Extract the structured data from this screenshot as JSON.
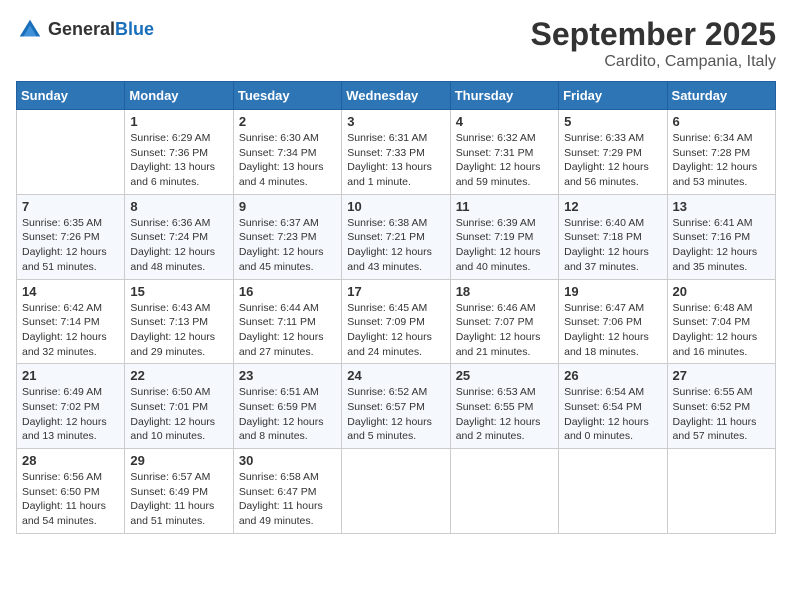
{
  "header": {
    "logo_general": "General",
    "logo_blue": "Blue",
    "month": "September 2025",
    "location": "Cardito, Campania, Italy"
  },
  "days_of_week": [
    "Sunday",
    "Monday",
    "Tuesday",
    "Wednesday",
    "Thursday",
    "Friday",
    "Saturday"
  ],
  "weeks": [
    [
      {
        "day": "",
        "sunrise": "",
        "sunset": "",
        "daylight": ""
      },
      {
        "day": "1",
        "sunrise": "Sunrise: 6:29 AM",
        "sunset": "Sunset: 7:36 PM",
        "daylight": "Daylight: 13 hours and 6 minutes."
      },
      {
        "day": "2",
        "sunrise": "Sunrise: 6:30 AM",
        "sunset": "Sunset: 7:34 PM",
        "daylight": "Daylight: 13 hours and 4 minutes."
      },
      {
        "day": "3",
        "sunrise": "Sunrise: 6:31 AM",
        "sunset": "Sunset: 7:33 PM",
        "daylight": "Daylight: 13 hours and 1 minute."
      },
      {
        "day": "4",
        "sunrise": "Sunrise: 6:32 AM",
        "sunset": "Sunset: 7:31 PM",
        "daylight": "Daylight: 12 hours and 59 minutes."
      },
      {
        "day": "5",
        "sunrise": "Sunrise: 6:33 AM",
        "sunset": "Sunset: 7:29 PM",
        "daylight": "Daylight: 12 hours and 56 minutes."
      },
      {
        "day": "6",
        "sunrise": "Sunrise: 6:34 AM",
        "sunset": "Sunset: 7:28 PM",
        "daylight": "Daylight: 12 hours and 53 minutes."
      }
    ],
    [
      {
        "day": "7",
        "sunrise": "Sunrise: 6:35 AM",
        "sunset": "Sunset: 7:26 PM",
        "daylight": "Daylight: 12 hours and 51 minutes."
      },
      {
        "day": "8",
        "sunrise": "Sunrise: 6:36 AM",
        "sunset": "Sunset: 7:24 PM",
        "daylight": "Daylight: 12 hours and 48 minutes."
      },
      {
        "day": "9",
        "sunrise": "Sunrise: 6:37 AM",
        "sunset": "Sunset: 7:23 PM",
        "daylight": "Daylight: 12 hours and 45 minutes."
      },
      {
        "day": "10",
        "sunrise": "Sunrise: 6:38 AM",
        "sunset": "Sunset: 7:21 PM",
        "daylight": "Daylight: 12 hours and 43 minutes."
      },
      {
        "day": "11",
        "sunrise": "Sunrise: 6:39 AM",
        "sunset": "Sunset: 7:19 PM",
        "daylight": "Daylight: 12 hours and 40 minutes."
      },
      {
        "day": "12",
        "sunrise": "Sunrise: 6:40 AM",
        "sunset": "Sunset: 7:18 PM",
        "daylight": "Daylight: 12 hours and 37 minutes."
      },
      {
        "day": "13",
        "sunrise": "Sunrise: 6:41 AM",
        "sunset": "Sunset: 7:16 PM",
        "daylight": "Daylight: 12 hours and 35 minutes."
      }
    ],
    [
      {
        "day": "14",
        "sunrise": "Sunrise: 6:42 AM",
        "sunset": "Sunset: 7:14 PM",
        "daylight": "Daylight: 12 hours and 32 minutes."
      },
      {
        "day": "15",
        "sunrise": "Sunrise: 6:43 AM",
        "sunset": "Sunset: 7:13 PM",
        "daylight": "Daylight: 12 hours and 29 minutes."
      },
      {
        "day": "16",
        "sunrise": "Sunrise: 6:44 AM",
        "sunset": "Sunset: 7:11 PM",
        "daylight": "Daylight: 12 hours and 27 minutes."
      },
      {
        "day": "17",
        "sunrise": "Sunrise: 6:45 AM",
        "sunset": "Sunset: 7:09 PM",
        "daylight": "Daylight: 12 hours and 24 minutes."
      },
      {
        "day": "18",
        "sunrise": "Sunrise: 6:46 AM",
        "sunset": "Sunset: 7:07 PM",
        "daylight": "Daylight: 12 hours and 21 minutes."
      },
      {
        "day": "19",
        "sunrise": "Sunrise: 6:47 AM",
        "sunset": "Sunset: 7:06 PM",
        "daylight": "Daylight: 12 hours and 18 minutes."
      },
      {
        "day": "20",
        "sunrise": "Sunrise: 6:48 AM",
        "sunset": "Sunset: 7:04 PM",
        "daylight": "Daylight: 12 hours and 16 minutes."
      }
    ],
    [
      {
        "day": "21",
        "sunrise": "Sunrise: 6:49 AM",
        "sunset": "Sunset: 7:02 PM",
        "daylight": "Daylight: 12 hours and 13 minutes."
      },
      {
        "day": "22",
        "sunrise": "Sunrise: 6:50 AM",
        "sunset": "Sunset: 7:01 PM",
        "daylight": "Daylight: 12 hours and 10 minutes."
      },
      {
        "day": "23",
        "sunrise": "Sunrise: 6:51 AM",
        "sunset": "Sunset: 6:59 PM",
        "daylight": "Daylight: 12 hours and 8 minutes."
      },
      {
        "day": "24",
        "sunrise": "Sunrise: 6:52 AM",
        "sunset": "Sunset: 6:57 PM",
        "daylight": "Daylight: 12 hours and 5 minutes."
      },
      {
        "day": "25",
        "sunrise": "Sunrise: 6:53 AM",
        "sunset": "Sunset: 6:55 PM",
        "daylight": "Daylight: 12 hours and 2 minutes."
      },
      {
        "day": "26",
        "sunrise": "Sunrise: 6:54 AM",
        "sunset": "Sunset: 6:54 PM",
        "daylight": "Daylight: 12 hours and 0 minutes."
      },
      {
        "day": "27",
        "sunrise": "Sunrise: 6:55 AM",
        "sunset": "Sunset: 6:52 PM",
        "daylight": "Daylight: 11 hours and 57 minutes."
      }
    ],
    [
      {
        "day": "28",
        "sunrise": "Sunrise: 6:56 AM",
        "sunset": "Sunset: 6:50 PM",
        "daylight": "Daylight: 11 hours and 54 minutes."
      },
      {
        "day": "29",
        "sunrise": "Sunrise: 6:57 AM",
        "sunset": "Sunset: 6:49 PM",
        "daylight": "Daylight: 11 hours and 51 minutes."
      },
      {
        "day": "30",
        "sunrise": "Sunrise: 6:58 AM",
        "sunset": "Sunset: 6:47 PM",
        "daylight": "Daylight: 11 hours and 49 minutes."
      },
      {
        "day": "",
        "sunrise": "",
        "sunset": "",
        "daylight": ""
      },
      {
        "day": "",
        "sunrise": "",
        "sunset": "",
        "daylight": ""
      },
      {
        "day": "",
        "sunrise": "",
        "sunset": "",
        "daylight": ""
      },
      {
        "day": "",
        "sunrise": "",
        "sunset": "",
        "daylight": ""
      }
    ]
  ]
}
